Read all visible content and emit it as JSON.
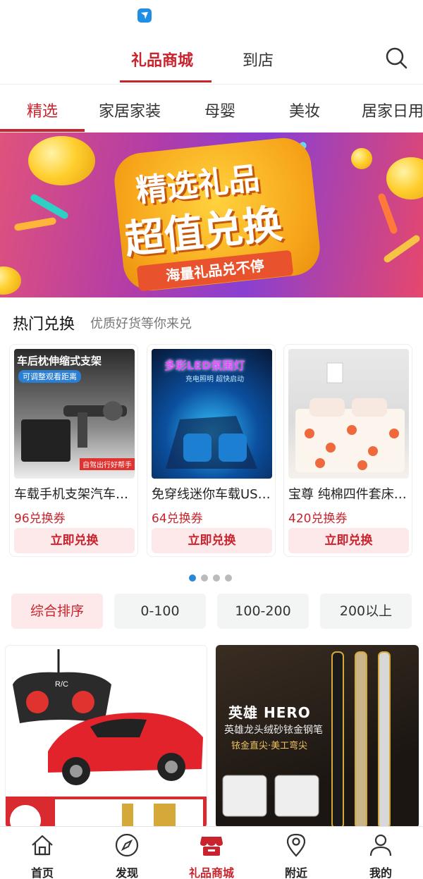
{
  "top_nav": {
    "tabs": [
      {
        "label": "礼品商城",
        "active": true
      },
      {
        "label": "到店",
        "active": false
      }
    ]
  },
  "categories": [
    {
      "label": "精选",
      "active": true
    },
    {
      "label": "家居家装"
    },
    {
      "label": "母婴"
    },
    {
      "label": "美妆"
    },
    {
      "label": "居家日用"
    }
  ],
  "banner": {
    "line1": "精选礼品",
    "line2": "超值兑换",
    "ribbon": "海量礼品兑不停"
  },
  "hot": {
    "title": "热门兑换",
    "subtitle": "优质好货等你来兑",
    "items": [
      {
        "name": "车载手机支架汽车后座头枕",
        "price": "96兑换券",
        "button": "立即兑换",
        "img_caption": "车后枕伸缩式支架",
        "img_tag": "可调整观看距离",
        "img_corner": "自驾出行好帮手"
      },
      {
        "name": "免穿线迷你车载USB氛围灯",
        "price": "64兑换券",
        "button": "立即兑换",
        "img_caption": "多彩LED氛围灯",
        "img_tag": "充电照明 超快启动"
      },
      {
        "name": "宝尊 纯棉四件套床上用品",
        "price": "420兑换券",
        "button": "立即兑换"
      }
    ],
    "pager": {
      "count": 4,
      "active_index": 0
    }
  },
  "filters": [
    {
      "label": "综合排序",
      "active": true
    },
    {
      "label": "0-100"
    },
    {
      "label": "100-200"
    },
    {
      "label": "200以上"
    }
  ],
  "products": [
    {
      "img_text": "R/C"
    },
    {
      "brand": "英雄 HERO",
      "desc1": "英雄龙头绒砂铱金钢笔",
      "desc2": "铱金直尖·美工弯尖"
    }
  ],
  "bottom_nav": [
    {
      "label": "首页",
      "icon": "home-icon"
    },
    {
      "label": "发现",
      "icon": "compass-icon"
    },
    {
      "label": "礼品商城",
      "icon": "shop-icon",
      "active": true
    },
    {
      "label": "附近",
      "icon": "location-icon"
    },
    {
      "label": "我的",
      "icon": "user-icon"
    }
  ],
  "colors": {
    "accent": "#c9232d",
    "accent_light": "#fde8ea",
    "pager_active": "#2a86d6"
  }
}
